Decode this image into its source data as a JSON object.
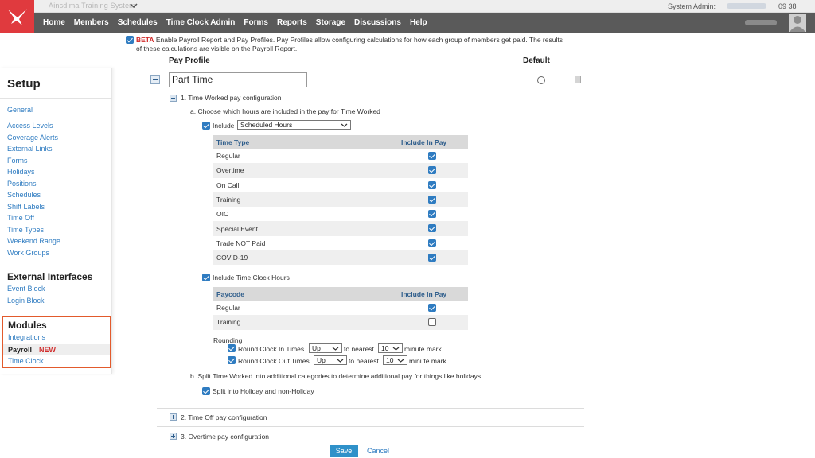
{
  "app": {
    "org_name": "Ainsdima Training System",
    "clock": "09 38",
    "admin_label": "System Admin:"
  },
  "nav": {
    "items": [
      "Home",
      "Members",
      "Schedules",
      "Time Clock Admin",
      "Forms",
      "Reports",
      "Storage",
      "Discussions",
      "Help"
    ]
  },
  "sidebar": {
    "title": "Setup",
    "general": "General",
    "links": [
      "Access Levels",
      "Coverage Alerts",
      "External Links",
      "Forms",
      "Holidays",
      "Positions",
      "Schedules",
      "Shift Labels",
      "Time Off",
      "Time Types",
      "Weekend Range",
      "Work Groups"
    ],
    "external_title": "External Interfaces",
    "external_links": [
      "Event Block",
      "Login Block"
    ],
    "modules_title": "Modules",
    "integrations": "Integrations",
    "payroll": "Payroll",
    "payroll_badge": "NEW",
    "time_clock": "Time Clock"
  },
  "main": {
    "beta_tag": "BETA",
    "beta_line1": "Enable Payroll Report and Pay Profiles. Pay Profiles allow configuring calculations for how each group of members get paid. The results",
    "beta_line2": "of these calculations are visible on the Payroll Report.",
    "col_pay_profile": "Pay Profile",
    "col_default": "Default",
    "profile_name": "Part Time",
    "section1_title": "1. Time Worked pay configuration",
    "step_a": "a. Choose which hours are included in the pay for Time Worked",
    "include_label": "Include",
    "include_select": "Scheduled Hours",
    "time_table": {
      "headers": [
        "Time Type",
        "Include In Pay"
      ],
      "rows": [
        {
          "name": "Regular",
          "checked": true
        },
        {
          "name": "Overtime",
          "checked": true
        },
        {
          "name": "On Call",
          "checked": true
        },
        {
          "name": "Training",
          "checked": true
        },
        {
          "name": "OIC",
          "checked": true
        },
        {
          "name": "Special Event",
          "checked": true
        },
        {
          "name": "Trade NOT Paid",
          "checked": true
        },
        {
          "name": "COVID-19",
          "checked": true
        }
      ]
    },
    "include_clock_label": "Include Time Clock Hours",
    "paycode_table": {
      "headers": [
        "Paycode",
        "Include In Pay"
      ],
      "rows": [
        {
          "name": "Regular",
          "checked": true
        },
        {
          "name": "Training",
          "checked": false
        }
      ]
    },
    "rounding_label": "Rounding",
    "round_in_label": "Round Clock In Times",
    "round_in_dir": "Up",
    "round_in_nearest": "to nearest",
    "round_in_min": "10",
    "round_in_suffix": "minute mark",
    "round_out_label": "Round Clock Out Times",
    "round_out_dir": "Up",
    "round_out_nearest": "to nearest",
    "round_out_min": "10",
    "round_out_suffix": "minute mark",
    "step_b": "b. Split Time Worked into additional categories to determine additional pay for things like holidays",
    "split_label": "Split into Holiday and non-Holiday",
    "section2_title": "2. Time Off pay configuration",
    "section3_title": "3. Overtime pay configuration",
    "save": "Save",
    "cancel": "Cancel"
  }
}
